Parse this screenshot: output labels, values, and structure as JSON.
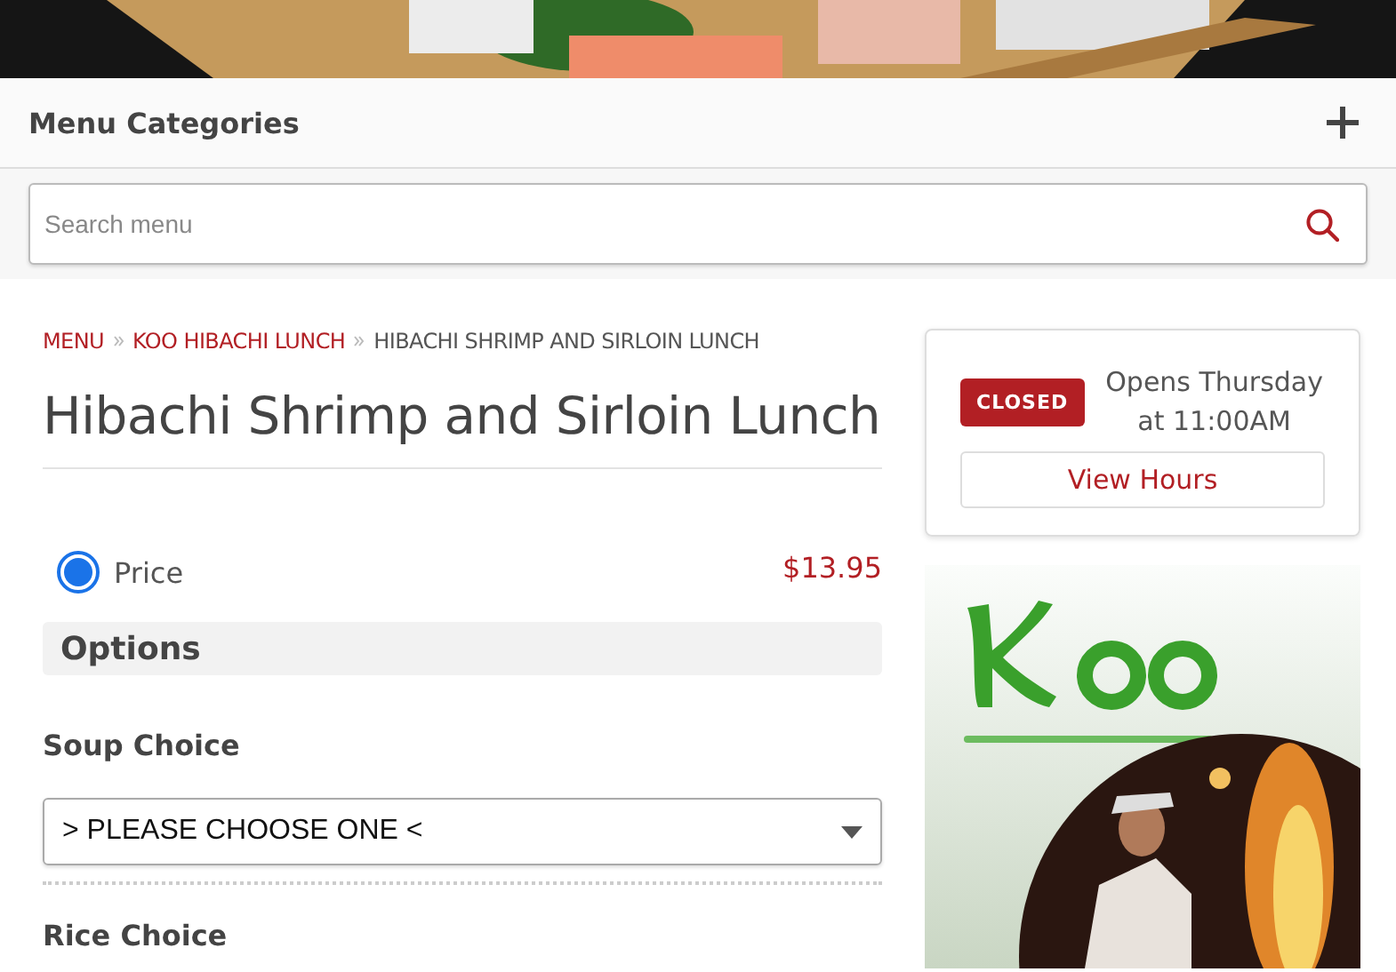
{
  "categories_bar": {
    "title": "Menu Categories",
    "expanded": false
  },
  "search": {
    "placeholder": "Search menu"
  },
  "breadcrumbs": [
    {
      "label": "MENU",
      "link": true
    },
    {
      "label": "KOO HIBACHI LUNCH",
      "link": true
    },
    {
      "label": "HIBACHI SHRIMP AND SIRLOIN LUNCH",
      "link": false
    }
  ],
  "item": {
    "title": "Hibachi Shrimp and Sirloin Lunch"
  },
  "prices": [
    {
      "label": "Price",
      "amount": "$13.95",
      "selected": true
    }
  ],
  "options_title": "Options",
  "choices": [
    {
      "label": "Soup Choice",
      "value": "> PLEASE CHOOSE ONE <"
    },
    {
      "label": "Rice Choice"
    }
  ],
  "hours": {
    "status": "CLOSED",
    "opens": "Opens Thursday",
    "time": "at 11:00AM",
    "button": "View Hours"
  }
}
